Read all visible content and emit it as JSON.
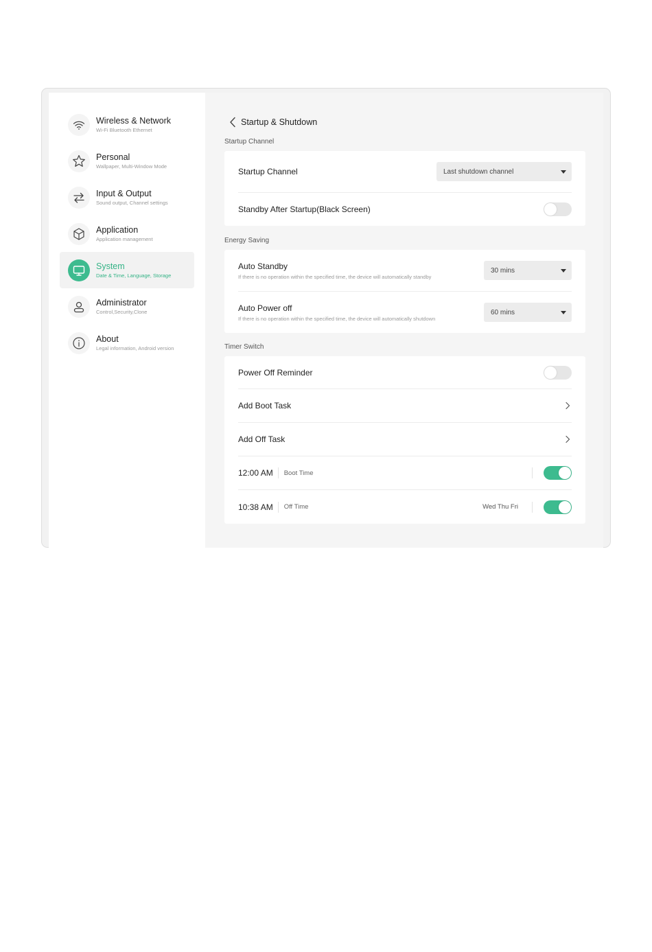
{
  "sidebar": {
    "items": [
      {
        "icon": "wifi-icon",
        "title": "Wireless & Network",
        "sub": "Wi-Fi Bluetooth Ethernet"
      },
      {
        "icon": "star-icon",
        "title": "Personal",
        "sub": "Wallpaper, Multi-Window Mode"
      },
      {
        "icon": "swap-arrows-icon",
        "title": "Input & Output",
        "sub": "Sound output, Channel settings"
      },
      {
        "icon": "cube-icon",
        "title": "Application",
        "sub": "Application management"
      },
      {
        "icon": "monitor-icon",
        "title": "System",
        "sub": "Date & Time, Language, Storage",
        "active": true
      },
      {
        "icon": "person-icon",
        "title": "Administrator",
        "sub": "Control,Security,Clone"
      },
      {
        "icon": "info-icon",
        "title": "About",
        "sub": "Legal information, Android version"
      }
    ]
  },
  "header": {
    "title": "Startup & Shutdown"
  },
  "startup": {
    "section_label": "Startup Channel",
    "channel_label": "Startup Channel",
    "channel_value": "Last shutdown channel",
    "standby_label": "Standby After Startup(Black Screen)",
    "standby_on": false
  },
  "energy": {
    "section_label": "Energy Saving",
    "auto_standby_label": "Auto Standby",
    "auto_standby_sub": "If there is no operation within the specified time, the device will automatically standby",
    "auto_standby_value": "30 mins",
    "auto_power_label": "Auto Power off",
    "auto_power_sub": "If there is no operation within the specified time, the device will automatically shutdown",
    "auto_power_value": "60 mins"
  },
  "timer": {
    "section_label": "Timer Switch",
    "reminder_label": "Power Off Reminder",
    "reminder_on": false,
    "add_boot_label": "Add Boot Task",
    "add_off_label": "Add Off Task",
    "tasks": [
      {
        "time": "12:00 AM",
        "type": "Boot Time",
        "days": "",
        "on": true
      },
      {
        "time": "10:38 AM",
        "type": "Off Time",
        "days": "Wed Thu Fri",
        "on": true
      }
    ]
  },
  "colors": {
    "accent": "#3dbb8f",
    "background": "#f5f5f5",
    "card": "#ffffff"
  }
}
